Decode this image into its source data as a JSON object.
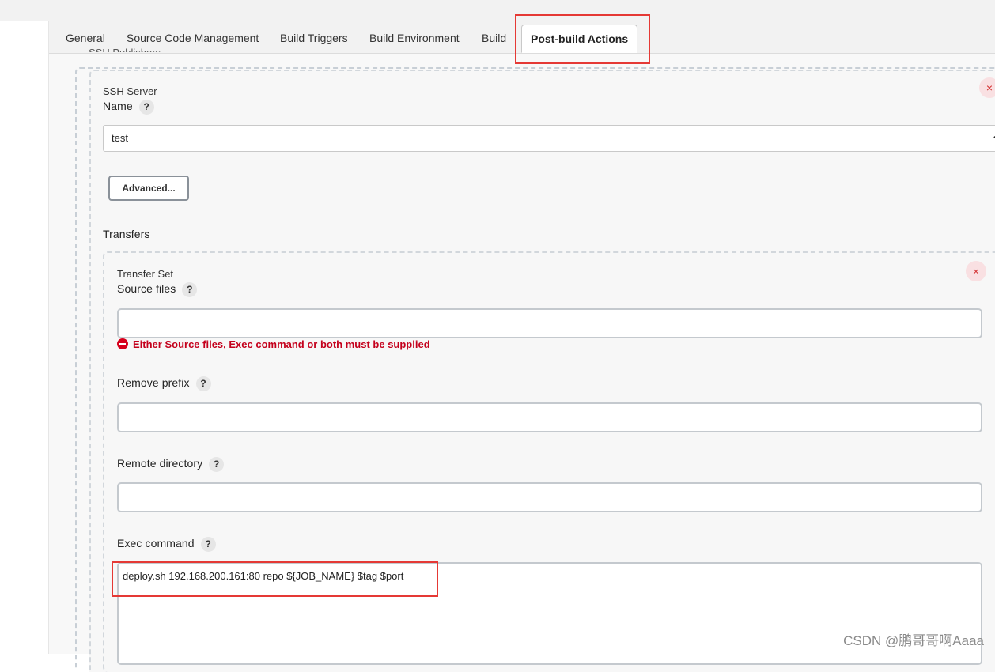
{
  "tabs": [
    {
      "label": "General"
    },
    {
      "label": "Source Code Management"
    },
    {
      "label": "Build Triggers"
    },
    {
      "label": "Build Environment"
    },
    {
      "label": "Build"
    },
    {
      "label": "Post-build Actions",
      "active": true
    }
  ],
  "section_title": "SSH Publishers",
  "ssh_server": {
    "heading": "SSH Server",
    "name_label": "Name",
    "name_value": "test",
    "advanced_label": "Advanced..."
  },
  "transfers": {
    "heading": "Transfers",
    "transfer_set": {
      "heading": "Transfer Set",
      "source_files_label": "Source files",
      "source_files_value": "",
      "error_text": "Either Source files, Exec command or both must be supplied",
      "remove_prefix_label": "Remove prefix",
      "remove_prefix_value": "",
      "remote_directory_label": "Remote directory",
      "remote_directory_value": "",
      "exec_command_label": "Exec command",
      "exec_command_value": "deploy.sh 192.168.200.161:80 repo ${JOB_NAME} $tag $port"
    }
  },
  "help_glyph": "?",
  "close_glyph": "×",
  "watermark": "CSDN @鹏哥哥啊Aaaa",
  "colors": {
    "highlight": "#e53935",
    "error": "#c4001c"
  }
}
